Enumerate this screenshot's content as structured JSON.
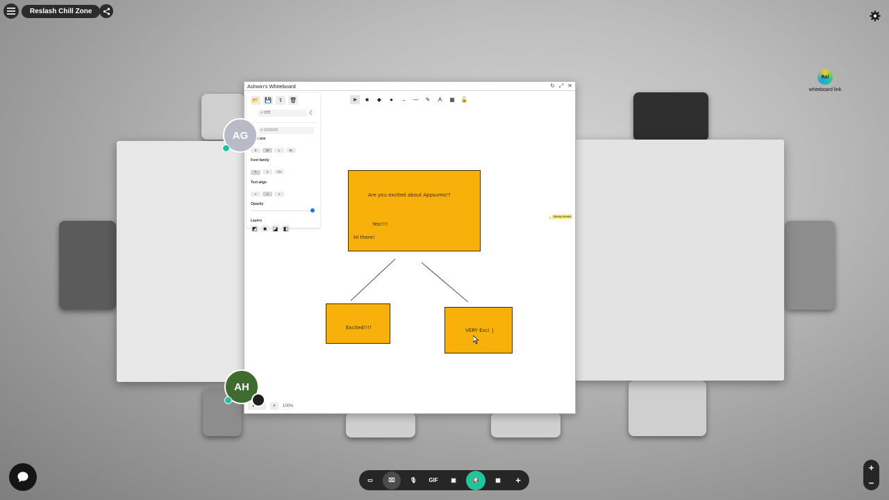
{
  "topbar": {
    "zone_name": "Reslash Chill Zone"
  },
  "link_widget": {
    "logo_text": "Re/",
    "label": "whiteboard link"
  },
  "whiteboard": {
    "title": "Ashwin's Whiteboard",
    "canvas_bg_hex": "ffffff",
    "stroke_hex": "000000",
    "font_size_label": "Font size",
    "font_size_options": [
      "S",
      "M",
      "L",
      "XL"
    ],
    "font_family_label": "Font family",
    "font_family_options": [
      "✎",
      "A",
      "</>"
    ],
    "text_align_label": "Text align",
    "text_align_options": [
      "≡",
      "≡",
      "≡"
    ],
    "opacity_label": "Opacity",
    "layers_label": "Layers",
    "zoom": "100%",
    "cursor_user": "Akshay Harsala",
    "notes": [
      {
        "lines": [
          "Are you excited about Appsumo!?",
          "Yes!!!!",
          "Hi there!"
        ]
      },
      {
        "lines": [
          "Excited!!!!"
        ]
      },
      {
        "lines": [
          "VERY Exci"
        ]
      }
    ]
  },
  "avatars": {
    "ag": "AG",
    "ah": "AH"
  },
  "colors": {
    "sticky": "#f7b10a",
    "accent": "#22c59a",
    "avatar_ag": "#b8bac8",
    "avatar_ah": "#3f6b2f"
  }
}
